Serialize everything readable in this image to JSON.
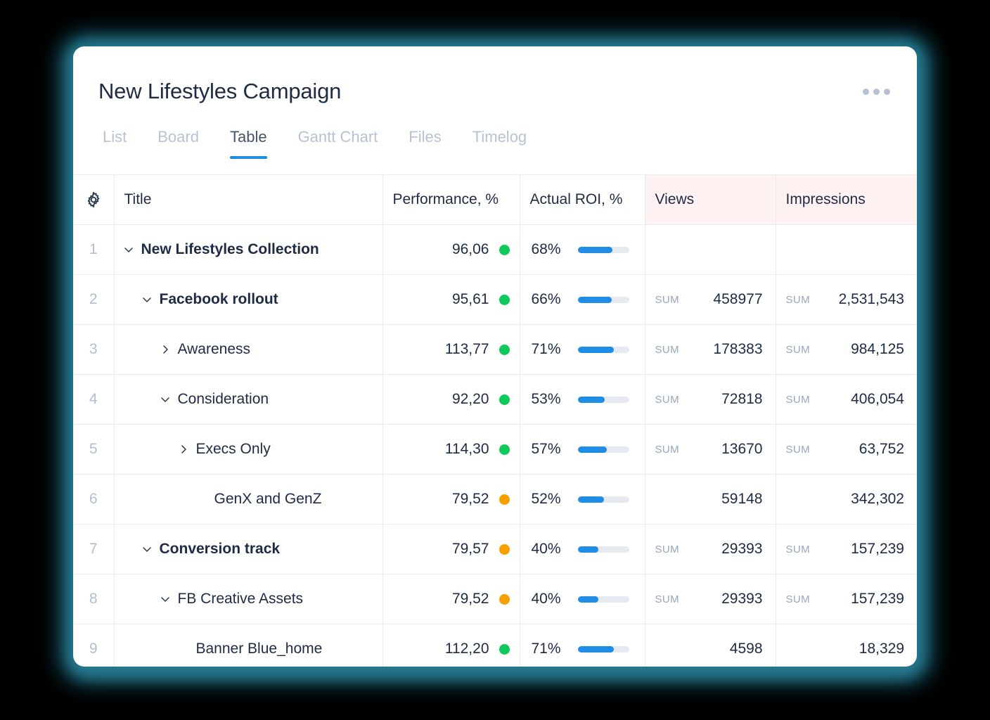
{
  "header": {
    "title": "New Lifestyles Campaign",
    "more_menu": "more-options"
  },
  "tabs": [
    {
      "label": "List",
      "active": false
    },
    {
      "label": "Board",
      "active": false
    },
    {
      "label": "Table",
      "active": true
    },
    {
      "label": "Gantt Chart",
      "active": false
    },
    {
      "label": "Files",
      "active": false
    },
    {
      "label": "Timelog",
      "active": false
    }
  ],
  "table": {
    "columns": [
      {
        "key": "num",
        "label": "",
        "highlight": false
      },
      {
        "key": "title",
        "label": "Title",
        "highlight": false
      },
      {
        "key": "performance",
        "label": "Performance, %",
        "highlight": false
      },
      {
        "key": "roi",
        "label": "Actual ROI, %",
        "highlight": false
      },
      {
        "key": "views",
        "label": "Views",
        "highlight": true
      },
      {
        "key": "impressions",
        "label": "Impressions",
        "highlight": true
      }
    ],
    "sum_label": "SUM",
    "rows": [
      {
        "num": "1",
        "title": "New Lifestyles Collection",
        "indent": 0,
        "chevron": "down",
        "bold": true,
        "performance": "96,06",
        "status": "green",
        "roi_pct": "68%",
        "roi_value": 68,
        "views": "",
        "views_sum": false,
        "impressions": "",
        "impressions_sum": false
      },
      {
        "num": "2",
        "title": "Facebook rollout",
        "indent": 1,
        "chevron": "down",
        "bold": true,
        "performance": "95,61",
        "status": "green",
        "roi_pct": "66%",
        "roi_value": 66,
        "views": "458977",
        "views_sum": true,
        "impressions": "2,531,543",
        "impressions_sum": true
      },
      {
        "num": "3",
        "title": "Awareness",
        "indent": 2,
        "chevron": "right",
        "bold": false,
        "performance": "113,77",
        "status": "green",
        "roi_pct": "71%",
        "roi_value": 71,
        "views": "178383",
        "views_sum": true,
        "impressions": "984,125",
        "impressions_sum": true
      },
      {
        "num": "4",
        "title": "Consideration",
        "indent": 2,
        "chevron": "down",
        "bold": false,
        "performance": "92,20",
        "status": "green",
        "roi_pct": "53%",
        "roi_value": 53,
        "views": "72818",
        "views_sum": true,
        "impressions": "406,054",
        "impressions_sum": true
      },
      {
        "num": "5",
        "title": "Execs Only",
        "indent": 3,
        "chevron": "right",
        "bold": false,
        "performance": "114,30",
        "status": "green",
        "roi_pct": "57%",
        "roi_value": 57,
        "views": "13670",
        "views_sum": true,
        "impressions": "63,752",
        "impressions_sum": true
      },
      {
        "num": "6",
        "title": "GenX and GenZ",
        "indent": 4,
        "chevron": "none",
        "bold": false,
        "performance": "79,52",
        "status": "orange",
        "roi_pct": "52%",
        "roi_value": 52,
        "views": "59148",
        "views_sum": false,
        "impressions": "342,302",
        "impressions_sum": false
      },
      {
        "num": "7",
        "title": "Conversion track",
        "indent": 1,
        "chevron": "down",
        "bold": true,
        "performance": "79,57",
        "status": "orange",
        "roi_pct": "40%",
        "roi_value": 40,
        "views": "29393",
        "views_sum": true,
        "impressions": "157,239",
        "impressions_sum": true
      },
      {
        "num": "8",
        "title": "FB Creative Assets",
        "indent": 2,
        "chevron": "down",
        "bold": false,
        "performance": "79,52",
        "status": "orange",
        "roi_pct": "40%",
        "roi_value": 40,
        "views": "29393",
        "views_sum": true,
        "impressions": "157,239",
        "impressions_sum": true
      },
      {
        "num": "9",
        "title": "Banner Blue_home",
        "indent": 3,
        "chevron": "none",
        "bold": false,
        "performance": "112,20",
        "status": "green",
        "roi_pct": "71%",
        "roi_value": 71,
        "views": "4598",
        "views_sum": false,
        "impressions": "18,329",
        "impressions_sum": false
      }
    ]
  },
  "colors": {
    "accent": "#1f8ce6",
    "status_green": "#0fc95b",
    "status_orange": "#f6a000",
    "highlight_column": "#fdf1f2",
    "text": "#1f2a44",
    "muted": "#b4bdd0"
  }
}
